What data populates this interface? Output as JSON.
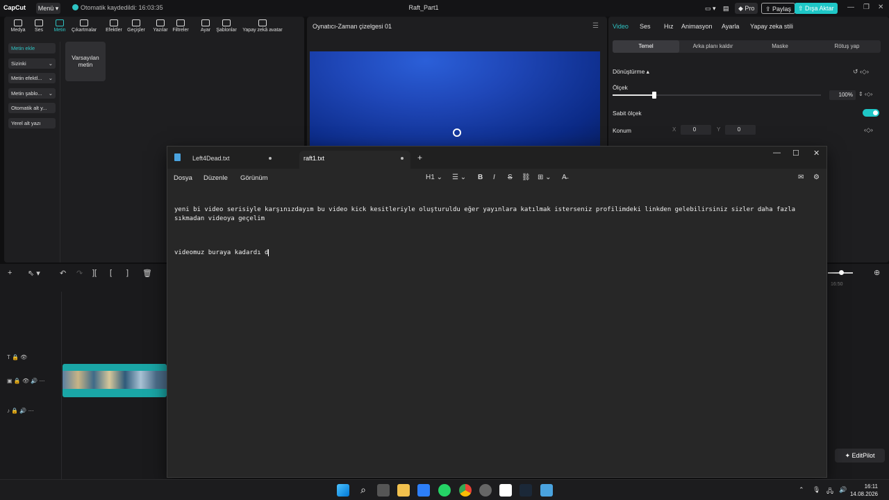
{
  "topbar": {
    "logo": "CapCut",
    "menu_label": "Menü",
    "autosave": "Otomatik kaydedildi: 16:03:35",
    "project_title": "Raft_Part1",
    "pro_label": "Pro",
    "share_label": "Paylaş",
    "export_label": "Dışa Aktar"
  },
  "tools": [
    "Medya",
    "Ses",
    "Metin",
    "Çıkartmalar",
    "Efektler",
    "Geçişler",
    "Yazılar",
    "Filtreler",
    "Ayar",
    "Şablonlar",
    "Yapay zekâ avatar"
  ],
  "active_tool": "Metin",
  "text_sidebar": [
    "Metin ekle",
    "Sizinki",
    "Metin efektl...",
    "Metin şablo...",
    "Otomatik alt y...",
    "Yerel alt yazı"
  ],
  "default_card": "Varsayılan metin",
  "player": {
    "title": "Oynatıcı-Zaman çizelgesi 01"
  },
  "right_panel": {
    "tabs": [
      "Video",
      "Ses",
      "Hız",
      "Animasyon",
      "Ayarla",
      "Yapay zeka stili"
    ],
    "subtabs": [
      "Temel",
      "Arka planı kaldır",
      "Maske",
      "Rötuş yap"
    ],
    "transform_label": "Dönüştürme",
    "scale_label": "Ölçek",
    "scale_value": "100%",
    "uniform_label": "Sabit ölçek",
    "position_label": "Konum",
    "pos_x_label": "X",
    "pos_x": "0",
    "pos_y_label": "Y",
    "pos_y": "0"
  },
  "timeline": {
    "time_label": "16:50"
  },
  "editpilot_label": "EditPilot",
  "notepad": {
    "tabs": [
      {
        "name": "Left4Dead.txt",
        "active": false
      },
      {
        "name": "raft1.txt",
        "active": true
      }
    ],
    "menu": [
      "Dosya",
      "Düzenle",
      "Görünüm"
    ],
    "heading_select": "H1",
    "text_line1": "yeni bi video serisiyle karşınızdayım bu video kick kesitleriyle oluşturuldu eğer yayınlara katılmak isterseniz profilimdeki linkden gelebilirsiniz sizler daha fazla sıkmadan videoya geçelim",
    "text_line2": "videomuz buraya kadardı d"
  },
  "taskbar": {
    "time": "16:11",
    "date": "14.08.2026"
  }
}
